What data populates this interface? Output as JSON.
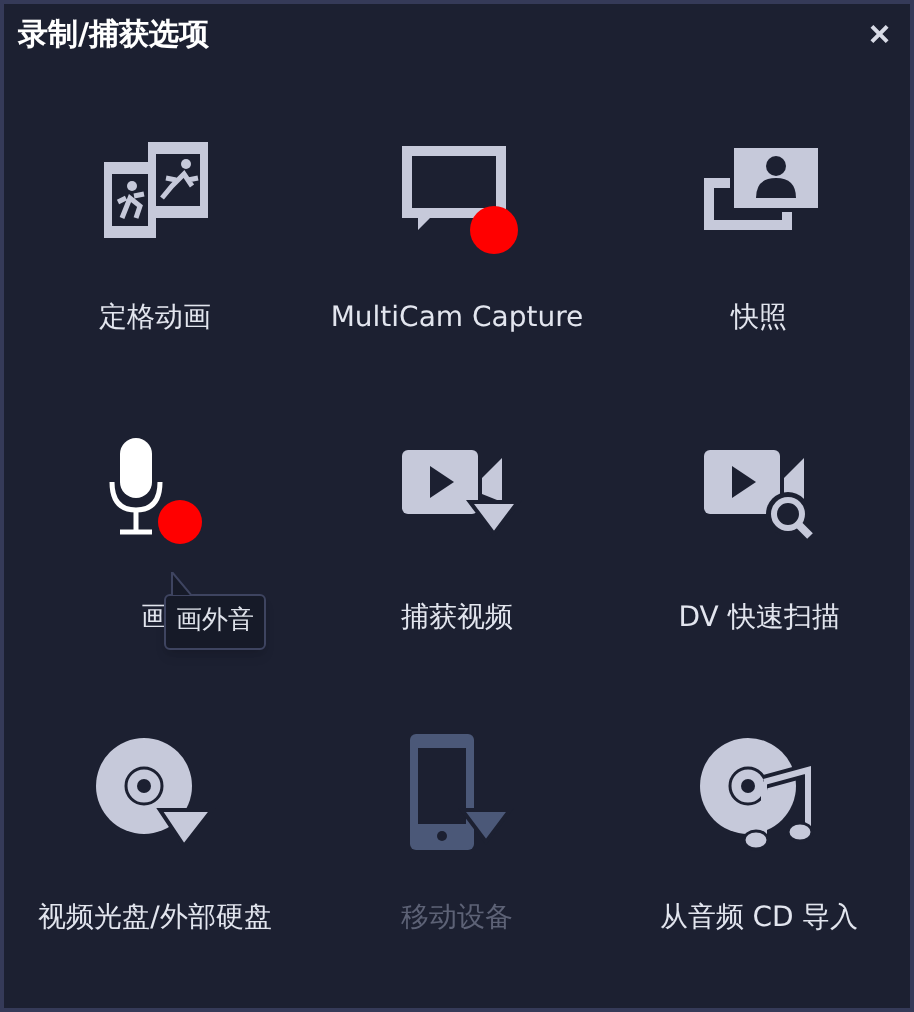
{
  "window": {
    "title": "录制/捕获选项",
    "close": "×"
  },
  "items": [
    {
      "kind": "stopmotion",
      "label": "定格动画",
      "disabled": false,
      "hovered": false
    },
    {
      "kind": "screen",
      "label": "MultiCam Capture",
      "disabled": false,
      "hovered": false
    },
    {
      "kind": "snapshot",
      "label": "快照",
      "disabled": false,
      "hovered": false
    },
    {
      "kind": "voiceover",
      "label": "画",
      "disabled": false,
      "hovered": true,
      "tooltip": "画外音"
    },
    {
      "kind": "capture-video",
      "label": "捕获视频",
      "disabled": false,
      "hovered": false
    },
    {
      "kind": "dv-scan",
      "label": "DV 快速扫描",
      "disabled": false,
      "hovered": false
    },
    {
      "kind": "disc",
      "label": "视频光盘/外部硬盘",
      "disabled": false,
      "hovered": false
    },
    {
      "kind": "mobile",
      "label": "移动设备",
      "disabled": true,
      "hovered": false
    },
    {
      "kind": "audio-cd",
      "label": "从音频 CD 导入",
      "disabled": false,
      "hovered": false
    }
  ]
}
